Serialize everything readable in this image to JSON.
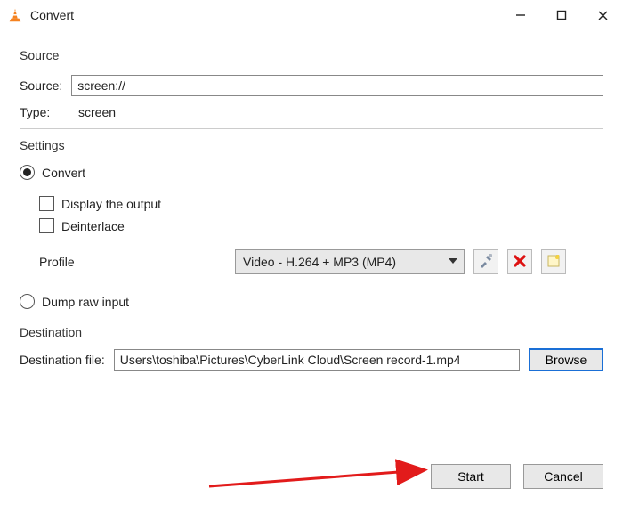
{
  "window": {
    "title": "Convert"
  },
  "source": {
    "section_label": "Source",
    "source_label": "Source:",
    "source_value": "screen://",
    "type_label": "Type:",
    "type_value": "screen"
  },
  "settings": {
    "section_label": "Settings",
    "convert_label": "Convert",
    "convert_checked": true,
    "display_output_label": "Display the output",
    "display_output_checked": false,
    "deinterlace_label": "Deinterlace",
    "deinterlace_checked": false,
    "profile_label": "Profile",
    "profile_value": "Video - H.264 + MP3 (MP4)",
    "dump_raw_label": "Dump raw input",
    "dump_raw_checked": false
  },
  "destination": {
    "section_label": "Destination",
    "file_label": "Destination file:",
    "file_value": "Users\\toshiba\\Pictures\\CyberLink Cloud\\Screen record-1.mp4",
    "browse_label": "Browse"
  },
  "buttons": {
    "start": "Start",
    "cancel": "Cancel"
  },
  "icons": {
    "tools": "tools-icon",
    "delete": "delete-icon",
    "new": "new-profile-icon"
  }
}
